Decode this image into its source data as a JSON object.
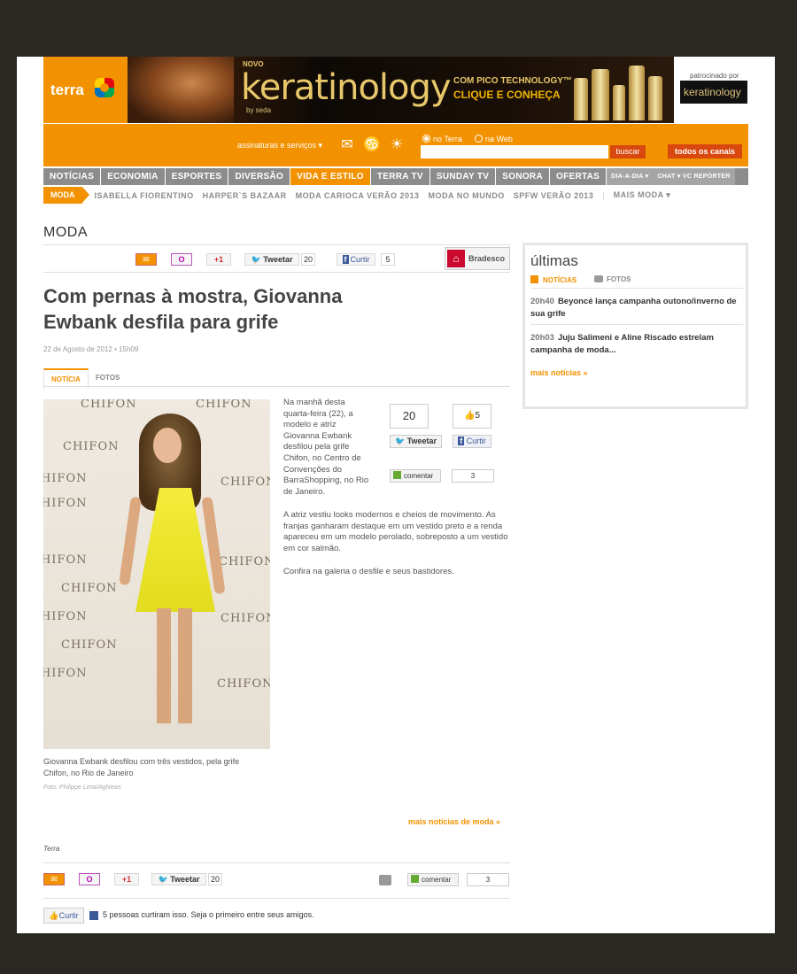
{
  "header": {
    "logo_text": "terra",
    "banner": {
      "novo": "NOVO",
      "brand": "keratinology",
      "by": "by seda",
      "tech": "COM PICO TECHNOLOGY™",
      "cta": "CLIQUE E CONHEÇA"
    },
    "sponsor_label": "patrocinado por",
    "sponsor_brand": "keratinology"
  },
  "searchbar": {
    "services_label": "assinaturas e serviços ▾",
    "radio_terra": "no Terra",
    "radio_web": "na Web",
    "search_value": "",
    "search_button": "buscar",
    "all_channels": "todos os canais"
  },
  "nav": {
    "items": [
      "NOTÍCIAS",
      "ECONOMIA",
      "ESPORTES",
      "DIVERSÃO",
      "VIDA E ESTILO",
      "TERRA TV",
      "SUNDAY TV",
      "SONORA",
      "OFERTAS"
    ],
    "extra": [
      "DIA-A-DIA ▾",
      "CHAT ▾ VC REPÓRTER"
    ]
  },
  "subnav": {
    "current": "MODA",
    "items": [
      "ISABELLA FIORENTINO",
      "HARPER`S BAZAAR",
      "MODA CARIOCA VERÃO 2013",
      "MODA NO MUNDO",
      "SPFW VERÃO 2013",
      "MAIS MODA ▾"
    ]
  },
  "section_title": "MODA",
  "share": {
    "gplus": "+1",
    "tweet": "Tweetar",
    "tweet_count": "20",
    "like": "Curtir",
    "like_count": "5",
    "comment": "comentar",
    "comment_count": "3",
    "sponsor": "Bradesco"
  },
  "article": {
    "title": "Com pernas à mostra, Giovanna Ewbank desfila para grife",
    "date": "22 de Agosto de 2012 • 15h09",
    "tabs": [
      "NOTÍCIA",
      "FOTOS"
    ],
    "photo_watermark": "CHIFON",
    "caption": "Giovanna Ewbank desfilou com três vestidos, pela grife Chifon, no Rio de Janeiro",
    "credit": "Foto: Philippe Lima/AgNews",
    "paragraphs": [
      "Na manhã desta quarta-feira (22), a modelo e atriz Giovanna Ewbank desfilou pela grife Chifon, no Centro de Convenções do BarraShopping, no Rio de Janeiro.",
      "A atriz vestiu looks modernos e cheios de movimento. As franjas ganharam destaque em um vestido preto e a renda apareceu em um modelo perolado, sobreposto a um vestido em cor salmão.",
      "Confira na galeria o desfile e seus bastidores."
    ],
    "widget_tweet_count": "20",
    "widget_like_count": "5",
    "more_link": "mais notícias de moda »",
    "source": "Terra",
    "like_text": "5 pessoas curtiram isso. Seja o primeiro entre seus amigos."
  },
  "sidebar": {
    "title": "últimas",
    "tab_news": "NOTÍCIAS",
    "tab_photos": "FOTOS",
    "news": [
      {
        "time": "20h40",
        "text": "Beyoncé lança campanha outono/inverno de sua grife"
      },
      {
        "time": "20h03",
        "text": "Juju Salimeni e Aline Riscado estrelam campanha de moda..."
      }
    ],
    "more": "mais notícias »"
  },
  "colors": {
    "accent": "#f39200",
    "nav_gray": "#8c8c8c",
    "button_red": "#d9480f",
    "facebook": "#3b5998",
    "twitter": "#3a9ad9"
  }
}
